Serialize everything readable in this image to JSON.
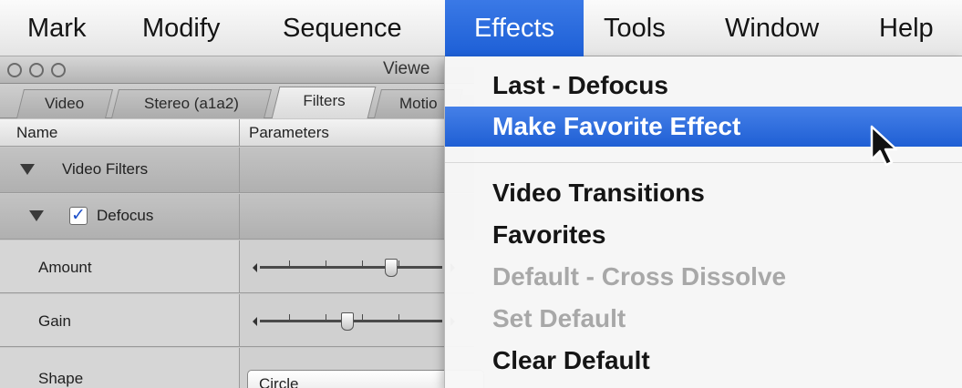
{
  "menubar": {
    "items": [
      "Mark",
      "Modify",
      "Sequence",
      "Effects",
      "Tools",
      "Window",
      "Help"
    ],
    "active": "Effects"
  },
  "viewer": {
    "title": "Viewe",
    "tabs": [
      "Video",
      "Stereo (a1a2)",
      "Filters",
      "Motio"
    ],
    "selected_tab": "Filters",
    "columns": {
      "name": "Name",
      "parameters": "Parameters"
    },
    "rows": {
      "video_filters": "Video Filters",
      "defocus": "Defocus",
      "defocus_enabled": true,
      "amount_label": "Amount",
      "amount_level": 0.72,
      "gain_label": "Gain",
      "gain_level": 0.48,
      "shape_label": "Shape",
      "shape_value": "Circle"
    }
  },
  "effects_menu": {
    "items": [
      {
        "label": "Last - Defocus",
        "state": "normal"
      },
      {
        "label": "Make Favorite Effect",
        "state": "highlighted"
      },
      {
        "label": "Video Transitions",
        "state": "normal"
      },
      {
        "label": "Favorites",
        "state": "normal"
      },
      {
        "label": "Default - Cross Dissolve",
        "state": "disabled"
      },
      {
        "label": "Set Default",
        "state": "disabled"
      },
      {
        "label": "Clear Default",
        "state": "normal"
      }
    ]
  },
  "icons": {
    "window_buttons": [
      "close-button-icon",
      "minimize-button-icon",
      "zoom-button-icon"
    ],
    "disclosure": "disclosure-triangle-icon",
    "checkbox": "checkmark-icon",
    "pointer": "mouse-pointer-icon"
  },
  "colors": {
    "highlight": "#2a6ce0",
    "disabled_text": "#a8a8a8"
  }
}
